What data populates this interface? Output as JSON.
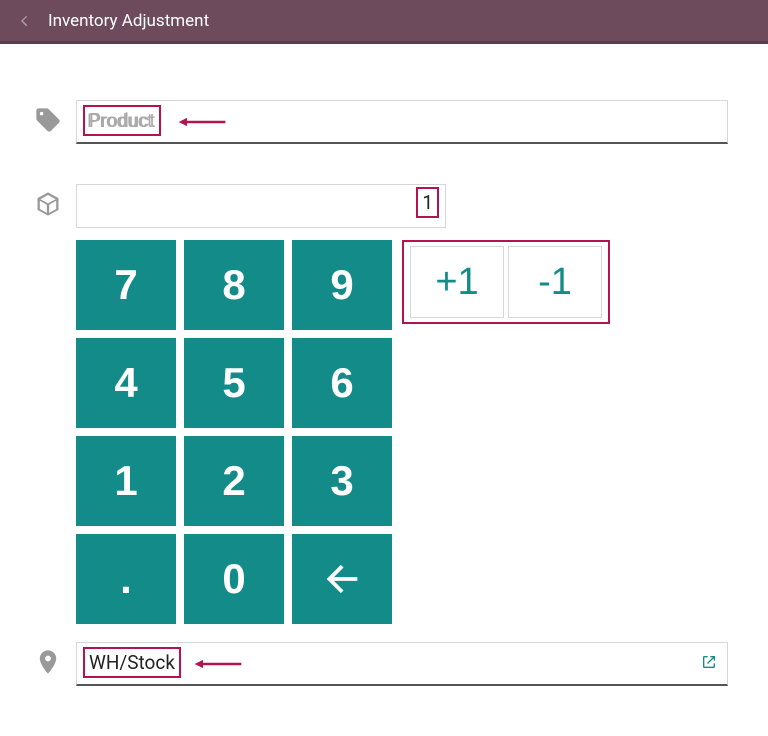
{
  "header": {
    "title": "Inventory Adjustment"
  },
  "product": {
    "placeholder": "Product"
  },
  "quantity": {
    "value": "1"
  },
  "keypad": {
    "keys": [
      "7",
      "8",
      "9",
      "4",
      "5",
      "6",
      "1",
      "2",
      "3",
      ".",
      "0",
      "←"
    ],
    "plus": "+1",
    "minus": "-1"
  },
  "location": {
    "value": "WH/Stock"
  }
}
